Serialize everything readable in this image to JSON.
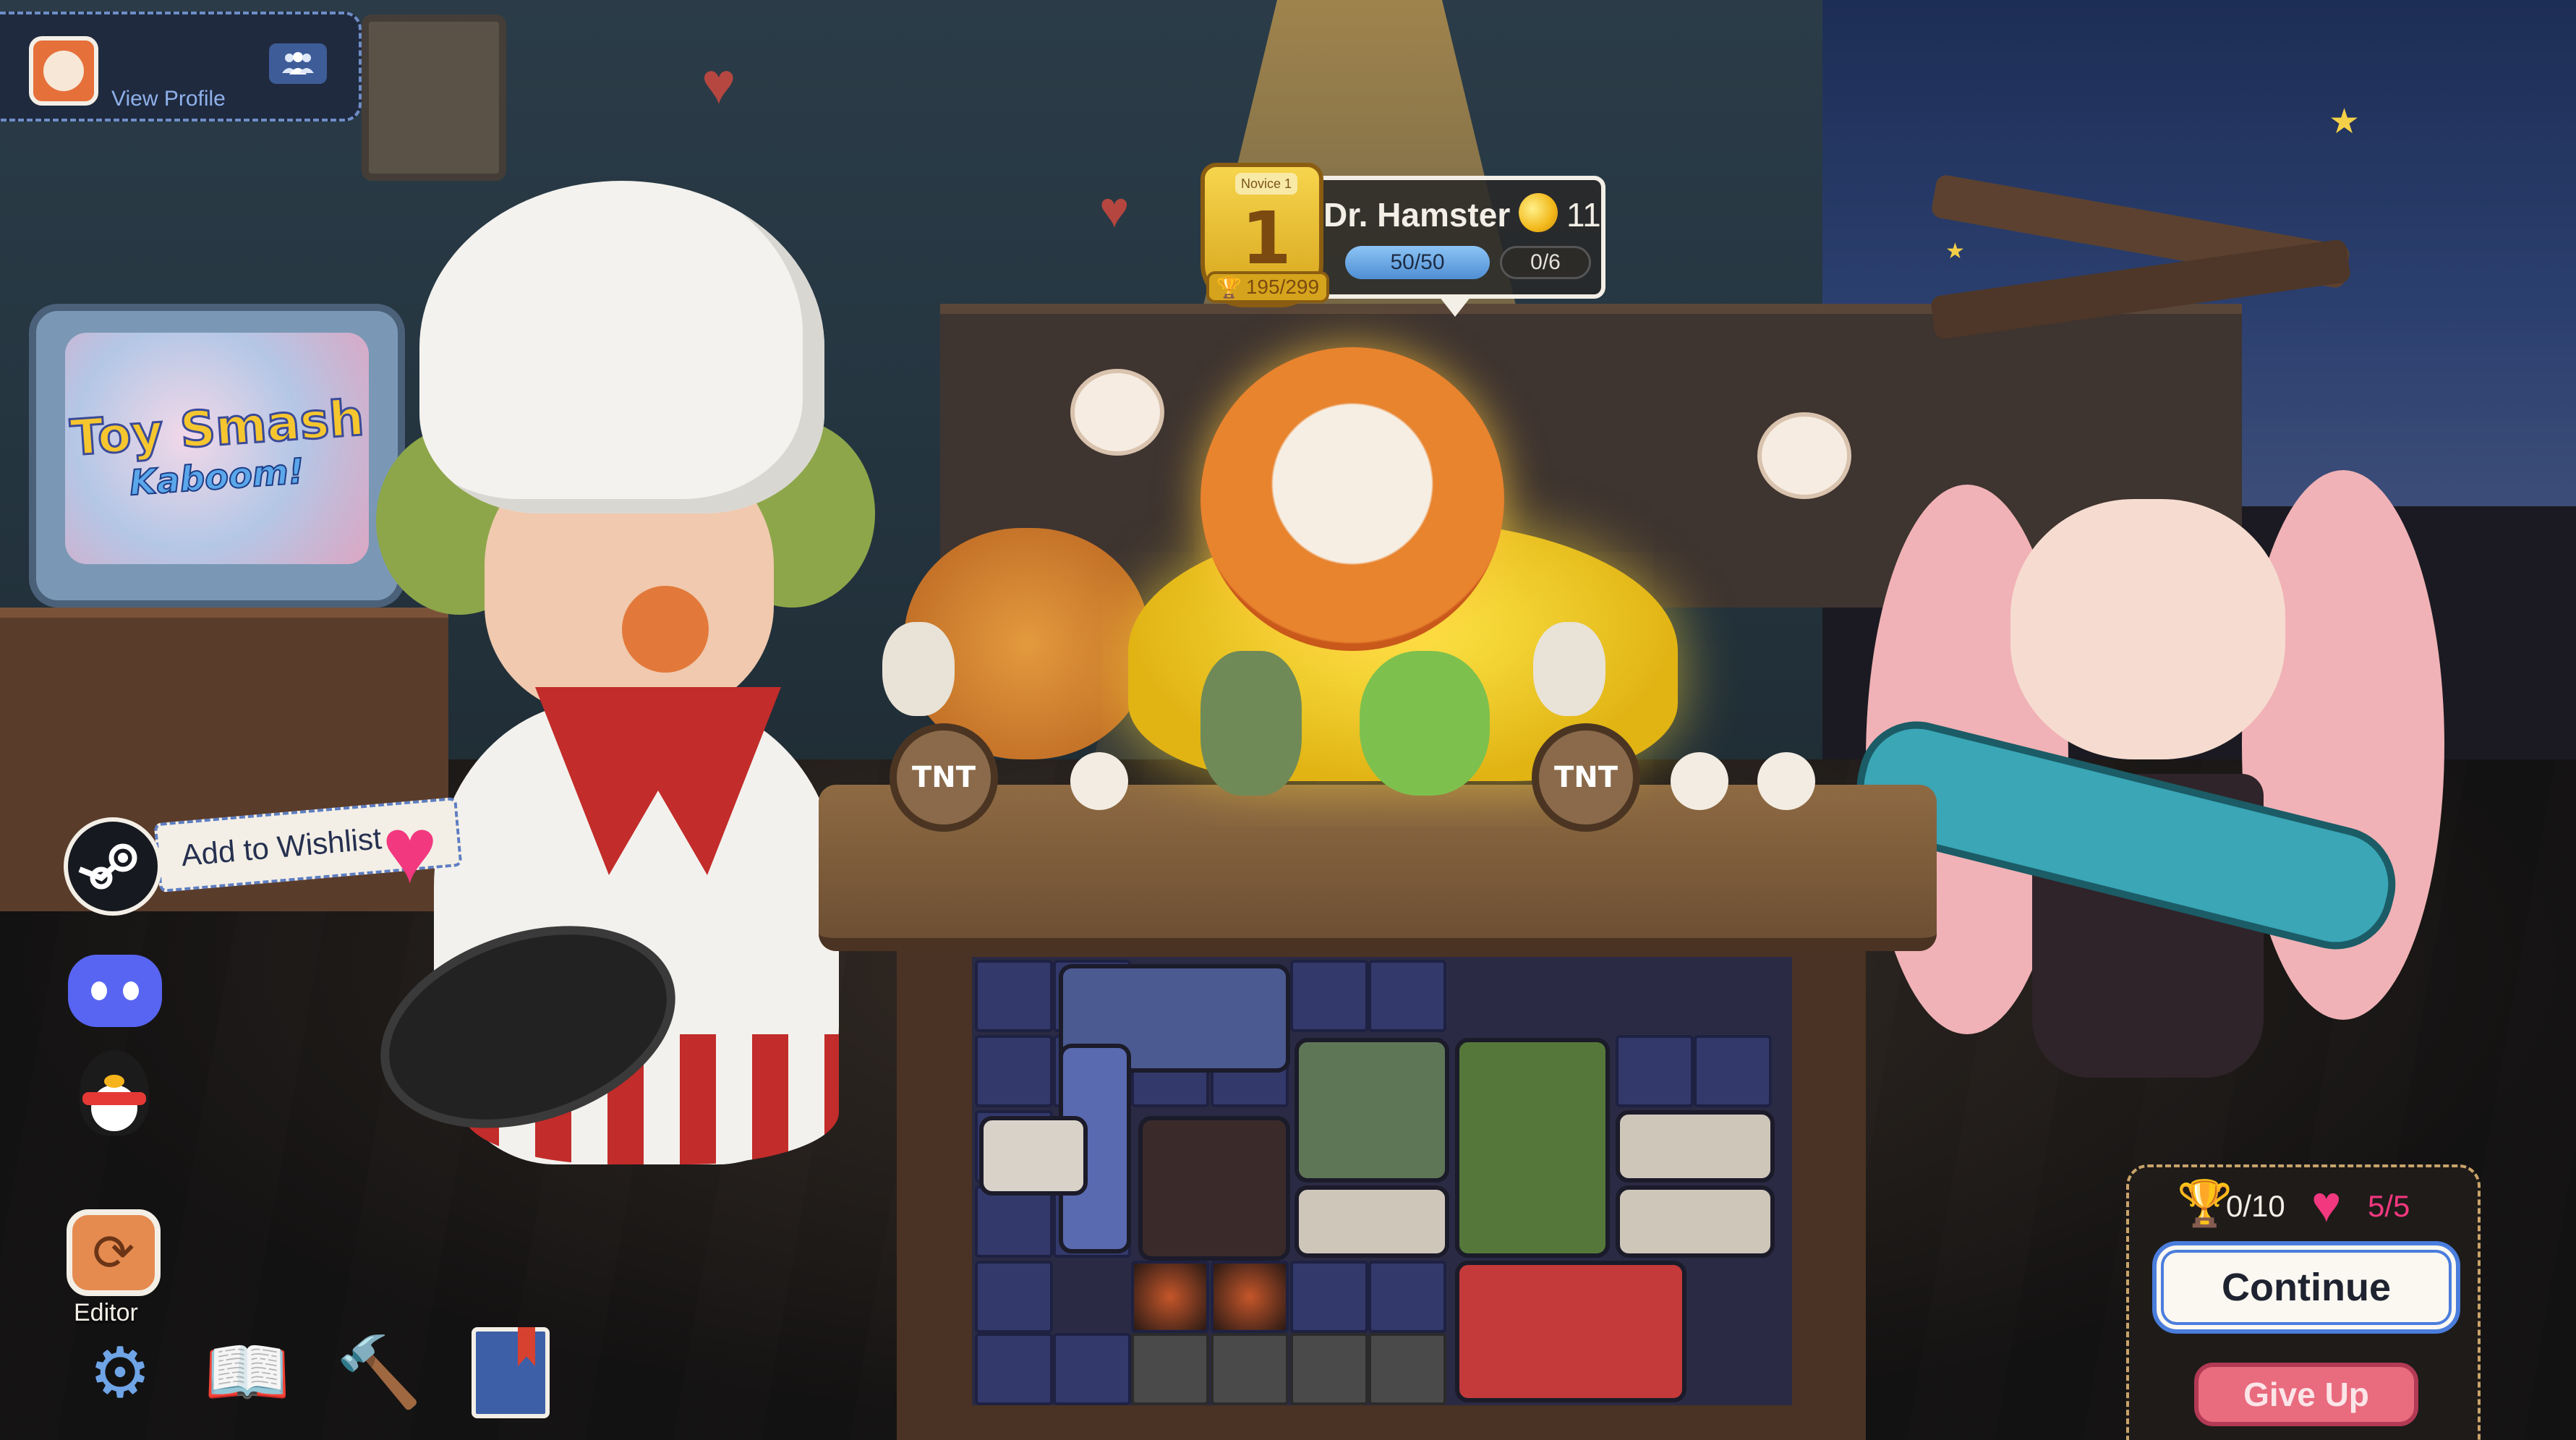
{
  "profile": {
    "view_label": "View Profile",
    "avatar_icon": "hamster-avatar-icon",
    "friends_icon": "friends-icon"
  },
  "tv": {
    "title": "Toy Smash",
    "subtitle": "Kaboom!"
  },
  "character_card": {
    "rank_label": "Novice 1",
    "rank": "1",
    "trophies": "195/299",
    "name": "Dr. Hamster",
    "coins": "11",
    "hp": "50/50",
    "hp_fraction": 1.0,
    "xp": "0/6",
    "xp_fraction": 0.0
  },
  "table": {
    "tnt_label": "TNT"
  },
  "left_menu": {
    "wishlist_label": "Add to Wishlist",
    "editor_label": "Editor",
    "icons": [
      "steam-icon",
      "discord-icon",
      "qq-icon",
      "editor-refresh-icon",
      "settings-gear-icon",
      "book-icon",
      "hammer-icon",
      "notebook-icon"
    ]
  },
  "result_panel": {
    "wins": "0/10",
    "lives": "5/5",
    "continue_label": "Continue",
    "give_up_label": "Give Up"
  },
  "colors": {
    "accent_blue": "#4a7ddc",
    "heart_pink": "#f2387f",
    "gold": "#f2b81a",
    "give_up_red": "#e96b7e"
  }
}
